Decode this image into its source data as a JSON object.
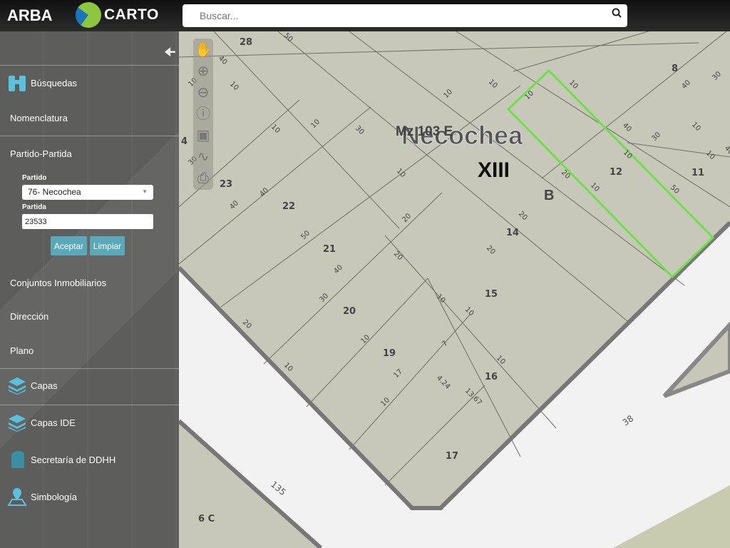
{
  "header": {
    "brand": "ARBA",
    "logo_text": "CARTO",
    "search_placeholder": "Buscar..."
  },
  "sidebar": {
    "collapse_icon": "arrow-left-icon",
    "items": [
      {
        "label": "Búsquedas",
        "icon": "binoculars-icon"
      },
      {
        "label": "Nomenclatura"
      },
      {
        "label": "Partido-Partida"
      },
      {
        "label": "Conjuntos Inmobiliarios"
      },
      {
        "label": "Dirección"
      },
      {
        "label": "Plano"
      },
      {
        "label": "Capas",
        "icon": "layers-icon"
      },
      {
        "label": "Capas IDE",
        "icon": "layers-ide-icon"
      },
      {
        "label": "Secretaría de DDHH",
        "icon": "ddhh-icon"
      },
      {
        "label": "Simbología",
        "icon": "map-pin-icon"
      }
    ],
    "form": {
      "partido_label": "Partido",
      "partido_value": "76- Necochea",
      "partida_label": "Partida",
      "partida_value": "23533",
      "accept": "Aceptar",
      "clear": "Limpiar"
    }
  },
  "map": {
    "toolbar": [
      "pan-hand-icon",
      "zoom-in-icon",
      "zoom-out-icon",
      "info-icon",
      "extent-icon",
      "measure-icon",
      "print-icon"
    ],
    "city": "Necochea",
    "section": "XIII",
    "block": "Mz 103 E",
    "subsection": "B",
    "highlight_color": "#6ee04a",
    "parcels": [
      "28",
      "8",
      "23",
      "22",
      "12",
      "11",
      "14",
      "21",
      "15",
      "20",
      "19",
      "16",
      "17",
      "4",
      "6 C"
    ],
    "streets": [
      "38",
      "135"
    ],
    "dimensions": [
      "50",
      "40",
      "10",
      "10",
      "10",
      "10",
      "10",
      "10",
      "10",
      "10",
      "30",
      "30",
      "40",
      "40",
      "50",
      "40",
      "20",
      "20",
      "20",
      "10",
      "10",
      "40",
      "50",
      "40",
      "30",
      "10",
      "40",
      "30",
      "10",
      "10",
      "20",
      "20",
      "30",
      "20",
      "10",
      "10",
      "10",
      "10",
      "17",
      "7",
      "10",
      "10",
      "4.24",
      "13.67"
    ]
  },
  "colors": {
    "accent": "#5aa9bb",
    "parcel_bg": "#c8c8ba",
    "road": "#f2f2f2"
  }
}
